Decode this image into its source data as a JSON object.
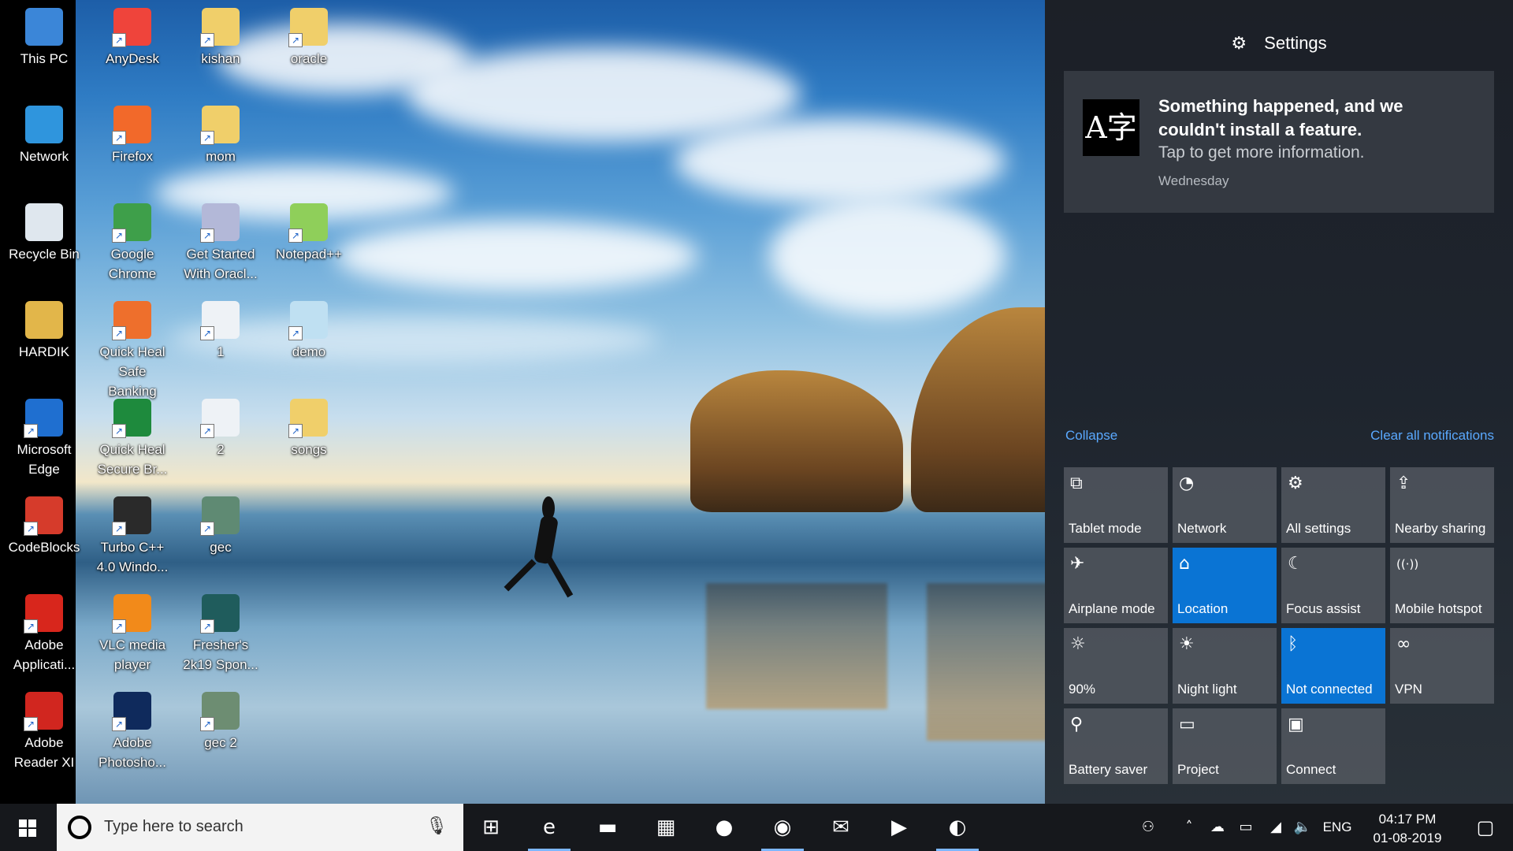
{
  "desktop": {
    "icons": [
      {
        "label": "This PC",
        "icon": "this-pc-icon",
        "color": "#3b86d8"
      },
      {
        "label": "Network",
        "icon": "network-icon",
        "color": "#2f95dd"
      },
      {
        "label": "Recycle Bin",
        "icon": "recycle-bin-icon",
        "color": "#dfe7ee"
      },
      {
        "label": "HARDIK",
        "icon": "user-folder-icon",
        "color": "#e2b64a"
      },
      {
        "label": "Microsoft Edge",
        "icon": "edge-icon",
        "color": "#1f6fd0"
      },
      {
        "label": "CodeBlocks",
        "icon": "codeblocks-icon",
        "color": "#d63b2b"
      },
      {
        "label": "Adobe Applicati...",
        "icon": "adobe-icon",
        "color": "#d8261c"
      },
      {
        "label": "Adobe Reader XI",
        "icon": "adobe-reader-icon",
        "color": "#d1261f"
      },
      {
        "label": "AnyDesk",
        "icon": "anydesk-icon",
        "color": "#ef443b"
      },
      {
        "label": "Firefox",
        "icon": "firefox-icon",
        "color": "#f2692a"
      },
      {
        "label": "Google Chrome",
        "icon": "chrome-icon",
        "color": "#3e9f4a"
      },
      {
        "label": "Quick Heal Safe Banking",
        "icon": "quick-heal-banking-icon",
        "color": "#ee6f2c"
      },
      {
        "label": "Quick Heal Secure Br...",
        "icon": "quick-heal-browser-icon",
        "color": "#1e8a3d"
      },
      {
        "label": "Turbo C++ 4.0 Windo...",
        "icon": "turbo-cpp-icon",
        "color": "#2a2a2a"
      },
      {
        "label": "VLC media player",
        "icon": "vlc-icon",
        "color": "#f28a1a"
      },
      {
        "label": "Adobe Photosho...",
        "icon": "photoshop-icon",
        "color": "#0f2a5c"
      },
      {
        "label": "kishan",
        "icon": "folder-icon",
        "color": "#f0cf6a"
      },
      {
        "label": "mom",
        "icon": "folder-icon",
        "color": "#f0cf6a"
      },
      {
        "label": "Get Started With Oracl...",
        "icon": "oracle-db-icon",
        "color": "#b3b8d8"
      },
      {
        "label": "1",
        "icon": "image-file-icon",
        "color": "#eef2f6"
      },
      {
        "label": "2",
        "icon": "image-file-icon",
        "color": "#eef2f6"
      },
      {
        "label": "gec",
        "icon": "photo-icon",
        "color": "#5f8a73"
      },
      {
        "label": "Fresher's 2k19 Spon...",
        "icon": "photo-icon",
        "color": "#1f5c5c"
      },
      {
        "label": "gec 2",
        "icon": "photo-icon",
        "color": "#6d8d72"
      },
      {
        "label": "oracle",
        "icon": "folder-icon",
        "color": "#f0cf6a"
      },
      {
        "label": "Notepad++",
        "icon": "notepad-plus-icon",
        "color": "#8fcf5a"
      },
      {
        "label": "demo",
        "icon": "notepad-file-icon",
        "color": "#bfe0f2"
      },
      {
        "label": "songs",
        "icon": "music-folder-icon",
        "color": "#f0cf6a"
      }
    ]
  },
  "action_center": {
    "header": {
      "title": "Settings",
      "icon": "gear-icon"
    },
    "notification": {
      "title": "Something happened, and we couldn't install a feature.",
      "body": "Tap to get more information.",
      "time": "Wednesday",
      "icon_glyph": "A字"
    },
    "collapse_label": "Collapse",
    "clear_label": "Clear all notifications",
    "quick_actions": [
      {
        "label": "Tablet mode",
        "icon": "tablet-mode-icon",
        "glyph": "⧉",
        "active": false
      },
      {
        "label": "Network",
        "icon": "network-icon",
        "glyph": "◔",
        "active": false
      },
      {
        "label": "All settings",
        "icon": "gear-icon",
        "glyph": "⚙",
        "active": false
      },
      {
        "label": "Nearby sharing",
        "icon": "nearby-sharing-icon",
        "glyph": "⇪",
        "active": false
      },
      {
        "label": "Airplane mode",
        "icon": "airplane-icon",
        "glyph": "✈",
        "active": false
      },
      {
        "label": "Location",
        "icon": "location-icon",
        "glyph": "⌂",
        "active": true
      },
      {
        "label": "Focus assist",
        "icon": "moon-icon",
        "glyph": "☾",
        "active": false
      },
      {
        "label": "Mobile hotspot",
        "icon": "hotspot-icon",
        "glyph": "((·))",
        "active": false
      },
      {
        "label": "90%",
        "icon": "brightness-icon",
        "glyph": "☼",
        "active": false
      },
      {
        "label": "Night light",
        "icon": "night-light-icon",
        "glyph": "☀",
        "active": false
      },
      {
        "label": "Not connected",
        "icon": "bluetooth-icon",
        "glyph": "ᛒ",
        "active": true
      },
      {
        "label": "VPN",
        "icon": "vpn-icon",
        "glyph": "∞",
        "active": false
      },
      {
        "label": "Battery saver",
        "icon": "battery-saver-icon",
        "glyph": "⚲",
        "active": false
      },
      {
        "label": "Project",
        "icon": "project-icon",
        "glyph": "▭",
        "active": false
      },
      {
        "label": "Connect",
        "icon": "connect-icon",
        "glyph": "▣",
        "active": false
      }
    ],
    "colors": {
      "accent": "#0a74d4",
      "link": "#5aa9ff"
    }
  },
  "taskbar": {
    "search_placeholder": "Type here to search",
    "pinned_apps": [
      {
        "name": "task-view-icon",
        "glyph": "⊞",
        "running": false
      },
      {
        "name": "edge-icon",
        "glyph": "e",
        "running": true
      },
      {
        "name": "file-explorer-icon",
        "glyph": "▬",
        "running": false
      },
      {
        "name": "store-icon",
        "glyph": "▦",
        "running": false
      },
      {
        "name": "firefox-icon",
        "glyph": "●",
        "running": false
      },
      {
        "name": "chrome-icon",
        "glyph": "◉",
        "running": true
      },
      {
        "name": "mail-icon",
        "glyph": "✉",
        "running": false
      },
      {
        "name": "media-player-icon",
        "glyph": "▶",
        "running": false
      },
      {
        "name": "turbo-cpp-icon",
        "glyph": "◐",
        "running": true
      }
    ],
    "tray": {
      "language": "ENG",
      "time": "04:17 PM",
      "date": "01-08-2019"
    }
  }
}
